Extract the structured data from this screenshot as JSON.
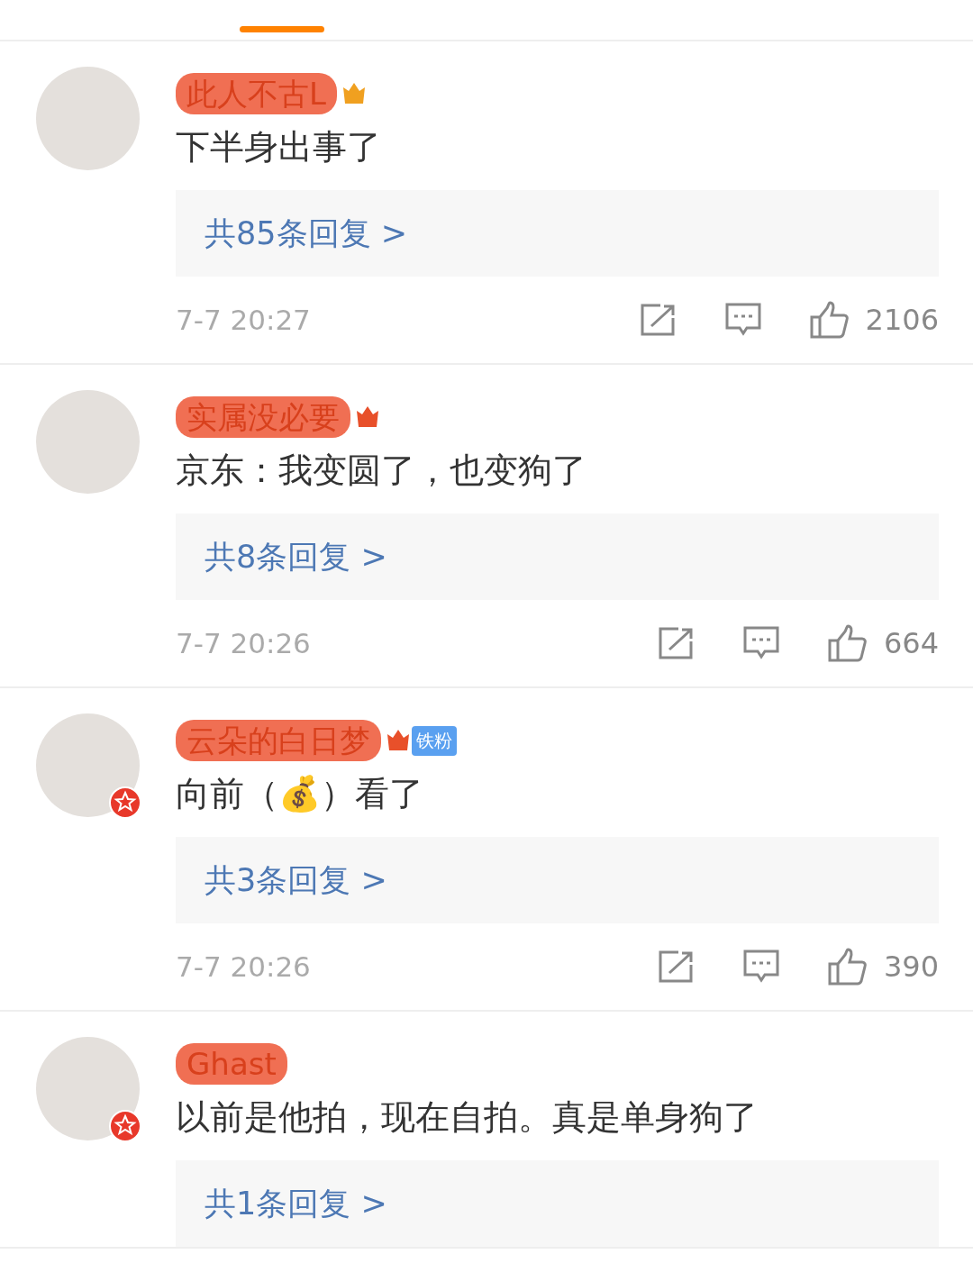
{
  "tab_bar": {
    "indicator": true
  },
  "comments": [
    {
      "name": "此人不古L",
      "color": "#f0a020",
      "verified": false,
      "text": "下半身出事了",
      "replies": "共85条回复 >",
      "time": "7-7 20:27",
      "likes": "2106"
    },
    {
      "name": "实属没必要",
      "color": "#e8502a",
      "verified": false,
      "text": "京东：我变圆了，也变狗了",
      "replies": "共8条回复 >",
      "time": "7-7 20:26",
      "likes": "664"
    },
    {
      "name": "云朵的白日梦",
      "color": "#e8502a",
      "fan_tag": "铁粉",
      "verified": true,
      "text": "向前（💰）看了",
      "replies": "共3条回复 >",
      "time": "7-7 20:26",
      "likes": "390"
    },
    {
      "name": "Ghast",
      "verified": true,
      "text": "以前是他拍，现在自拍。真是单身狗了",
      "replies": "共1条回复 >"
    }
  ]
}
